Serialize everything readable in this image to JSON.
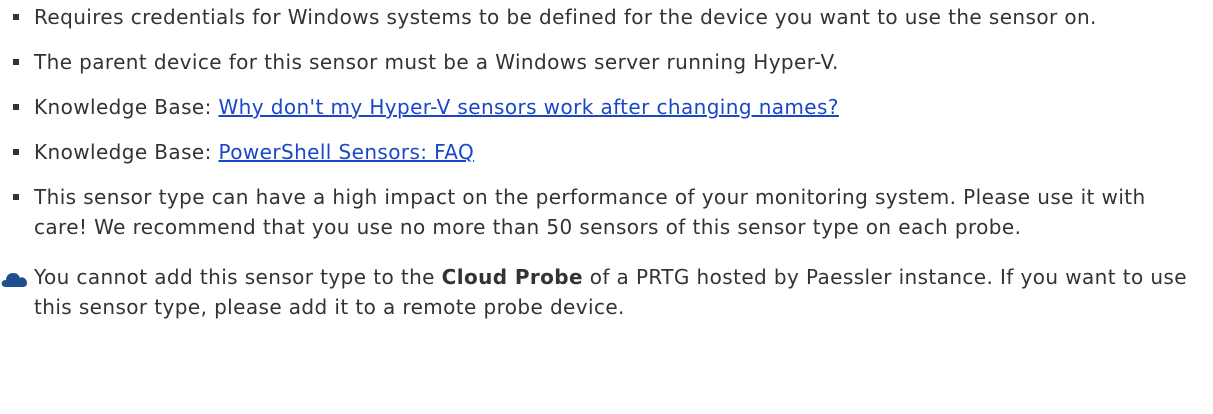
{
  "bullets": [
    {
      "text": "Requires credentials for Windows systems to be defined for the device you want to use the sensor on."
    },
    {
      "text": "The parent device for this sensor must be a Windows server running Hyper-V."
    },
    {
      "prefix": "Knowledge Base: ",
      "link": "Why don't my Hyper-V sensors work after changing names?"
    },
    {
      "prefix": "Knowledge Base: ",
      "link": "PowerShell Sensors: FAQ"
    },
    {
      "text": "This sensor type can have a high impact on the performance of your monitoring system. Please use it with care! We recommend that you use no more than 50 sensors of this sensor type on each probe."
    }
  ],
  "note": {
    "icon": "cloud-icon",
    "before": "You cannot add this sensor type to the ",
    "bold": "Cloud Probe",
    "after": " of a PRTG hosted by Paessler instance. If you want to use this sensor type, please add it to a remote probe device."
  },
  "colors": {
    "text": "#333333",
    "link": "#1a47c8",
    "cloud_icon": "#1e4f8f"
  }
}
